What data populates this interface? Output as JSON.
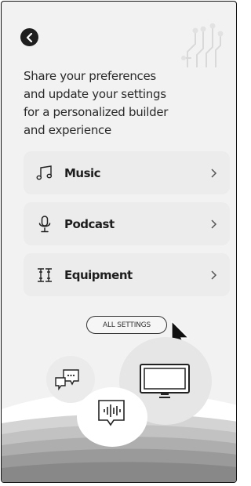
{
  "header": {
    "back_icon": "chevron-left-icon",
    "decor_icon": "circuit-icon"
  },
  "intro_text": "Share your preferences and update your settings for a personalized builder and experience",
  "cards": [
    {
      "label": "Music",
      "icon": "music-note-icon"
    },
    {
      "label": "Podcast",
      "icon": "microphone-icon"
    },
    {
      "label": "Equipment",
      "icon": "equipment-icon"
    }
  ],
  "all_settings_label": "ALL SETTINGS",
  "illustration": {
    "icons": [
      "chat-bubbles-icon",
      "monitor-icon",
      "voice-message-icon",
      "cursor-icon"
    ]
  },
  "colors": {
    "background": "#f2f2f2",
    "card": "#ececec",
    "text": "#1e1e1e"
  }
}
